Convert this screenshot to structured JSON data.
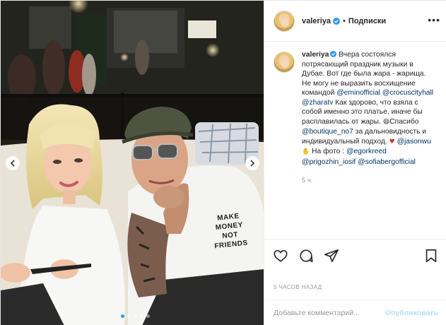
{
  "post": {
    "author": "valeriya",
    "follow_label": "Подписки",
    "separator": "•",
    "more_label": "•••",
    "shirt_text": [
      "MAKE",
      "MONEY",
      "NOT",
      "FRIENDS"
    ],
    "carousel": {
      "slide_count": 5,
      "active_index": 0
    },
    "caption": {
      "author": "valeriya",
      "text1": " Вчера состоялся потрясающий праздник музыки в Дубае. Вот где была жара - жарища. Не могу не выразить восхищение командой ",
      "mention_emin": "@eminofficial",
      "mention_crocus": "@crocuscityhall",
      "mention_zharatv": "@zharatv",
      "text2": " Как здорово, что взяла с собой именно это платье, иначе бы расплавилась от жары. ",
      "emoji_smile": "😄",
      "text3": "Спасибо ",
      "mention_boutique": "@boutique_no7",
      "text4": " за дальновидность и индивидуальный подход. ",
      "emoji_heart": "♥",
      "mention_jasonwu": "@jasonwu",
      "emoji_hand": "✋",
      "text5": " На фото : ",
      "mention_egor": "@egorkreed",
      "mention_prigozhin": "@prigozhin_iosif",
      "mention_sofiaberg": "@sofiabergofficial",
      "time": "5 ч."
    },
    "timestamp": "5 ЧАСОВ НАЗАД",
    "comment_input": {
      "placeholder": "Добавьте комментарий...",
      "value": ""
    },
    "publish_label": "Опубликовать",
    "colors": {
      "accent": "#3897f0",
      "link": "#003569",
      "publish_disabled": "#b2dffc",
      "heart": "#c0392b"
    },
    "icons": [
      "chevron-left-icon",
      "chevron-right-icon",
      "verified-icon",
      "heart-icon",
      "comment-icon",
      "share-icon",
      "bookmark-icon"
    ]
  }
}
